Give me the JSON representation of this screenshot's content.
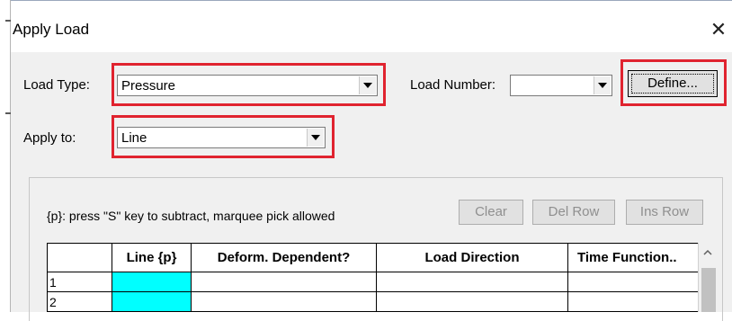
{
  "dialog": {
    "title": "Apply Load",
    "close_glyph": "✕"
  },
  "load_type": {
    "label": "Load Type:",
    "value": "Pressure"
  },
  "load_number": {
    "label": "Load Number:",
    "value": ""
  },
  "define_button": "Define...",
  "apply_to": {
    "label": "Apply to:",
    "value": "Line"
  },
  "hint": "{p}: press \"S\" key to subtract, marquee pick allowed",
  "buttons": {
    "clear": "Clear",
    "del_row": "Del Row",
    "ins_row": "Ins Row"
  },
  "grid": {
    "columns": [
      "Line {p}",
      "Deform. Dependent?",
      "Load Direction",
      "Time Function.."
    ],
    "rows": [
      "1",
      "2"
    ]
  },
  "colors": {
    "highlight": "#e0232f",
    "cell_selected": "#00ffff"
  },
  "icons": [
    "close-icon",
    "dropdown-arrow-icon",
    "scroll-up-icon"
  ]
}
